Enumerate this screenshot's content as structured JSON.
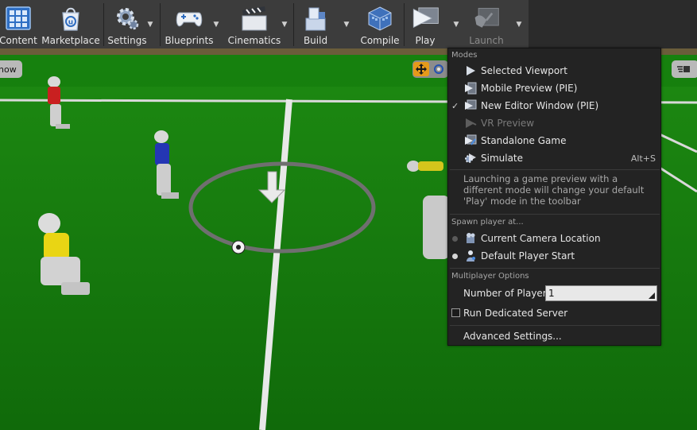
{
  "toolbar": {
    "buttons": [
      {
        "label": "Content",
        "icon": "content-browser-icon"
      },
      {
        "label": "Marketplace",
        "icon": "marketplace-icon"
      },
      {
        "label": "Settings",
        "icon": "settings-icon"
      },
      {
        "label": "Blueprints",
        "icon": "blueprints-gamepad-icon"
      },
      {
        "label": "Cinematics",
        "icon": "cinematics-clapper-icon"
      },
      {
        "label": "Build",
        "icon": "build-blocks-icon"
      },
      {
        "label": "Compile",
        "icon": "compile-cube-icon"
      },
      {
        "label": "Play",
        "icon": "play-icon"
      },
      {
        "label": "Launch",
        "icon": "launch-icon",
        "disabled": true
      }
    ],
    "dropdown_glyph": "▼"
  },
  "viewport": {
    "show_label": "how",
    "accent_orange": "#e59a1a"
  },
  "menu": {
    "modes_header": "Modes",
    "modes": [
      {
        "label": "Selected Viewport",
        "icon": "play-viewport-icon",
        "checked": false,
        "disabled": false,
        "shortcut": ""
      },
      {
        "label": "Mobile Preview (PIE)",
        "icon": "mobile-preview-icon",
        "checked": false,
        "disabled": false,
        "shortcut": ""
      },
      {
        "label": "New Editor Window (PIE)",
        "icon": "new-window-icon",
        "checked": true,
        "disabled": false,
        "shortcut": ""
      },
      {
        "label": "VR Preview",
        "icon": "vr-preview-icon",
        "checked": false,
        "disabled": true,
        "shortcut": ""
      },
      {
        "label": "Standalone Game",
        "icon": "standalone-game-icon",
        "checked": false,
        "disabled": false,
        "shortcut": ""
      },
      {
        "label": "Simulate",
        "icon": "simulate-icon",
        "checked": false,
        "disabled": false,
        "shortcut": "Alt+S"
      }
    ],
    "check_glyph": "✓",
    "modes_note": "Launching a game preview with a different mode will change your default 'Play' mode in the toolbar",
    "spawn_header": "Spawn player at...",
    "spawn": [
      {
        "label": "Current Camera Location",
        "icon": "camera-location-icon",
        "selected": false
      },
      {
        "label": "Default Player Start",
        "icon": "player-start-icon",
        "selected": true
      }
    ],
    "multiplayer_header": "Multiplayer Options",
    "players_label": "Number of Players",
    "players_value": "1",
    "dedicated_label": "Run Dedicated Server",
    "dedicated_checked": false,
    "advanced_label": "Advanced Settings..."
  }
}
